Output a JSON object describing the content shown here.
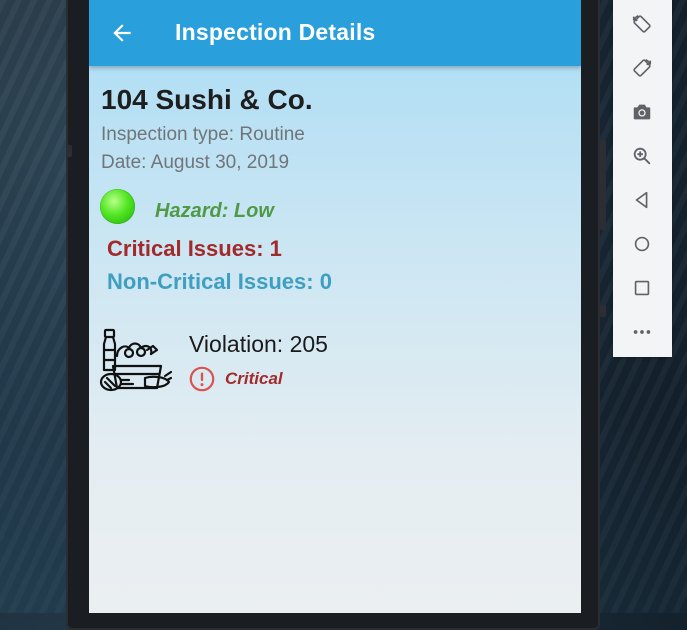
{
  "app_bar": {
    "title": "Inspection Details"
  },
  "restaurant": {
    "name": "104 Sushi & Co.",
    "inspection_type": "Inspection type: Routine",
    "date": "Date: August 30, 2019"
  },
  "hazard": {
    "label": "Hazard: Low",
    "color": "#4fe01c"
  },
  "issues": {
    "critical": "Critical Issues: 1",
    "non_critical": "Non-Critical Issues: 0"
  },
  "violations": [
    {
      "label": "Violation: 205",
      "severity": "Critical",
      "icon": "groceries-icon"
    }
  ],
  "emulator_toolbar": [
    "rotate-left-icon",
    "rotate-right-icon",
    "camera-icon",
    "zoom-icon",
    "back-icon",
    "home-icon",
    "overview-icon",
    "more-icon"
  ],
  "colors": {
    "app_bar": "#299fdb",
    "critical": "#a22a2a",
    "non_critical": "#3f9fc1",
    "hazard_text": "#4f9a45"
  }
}
